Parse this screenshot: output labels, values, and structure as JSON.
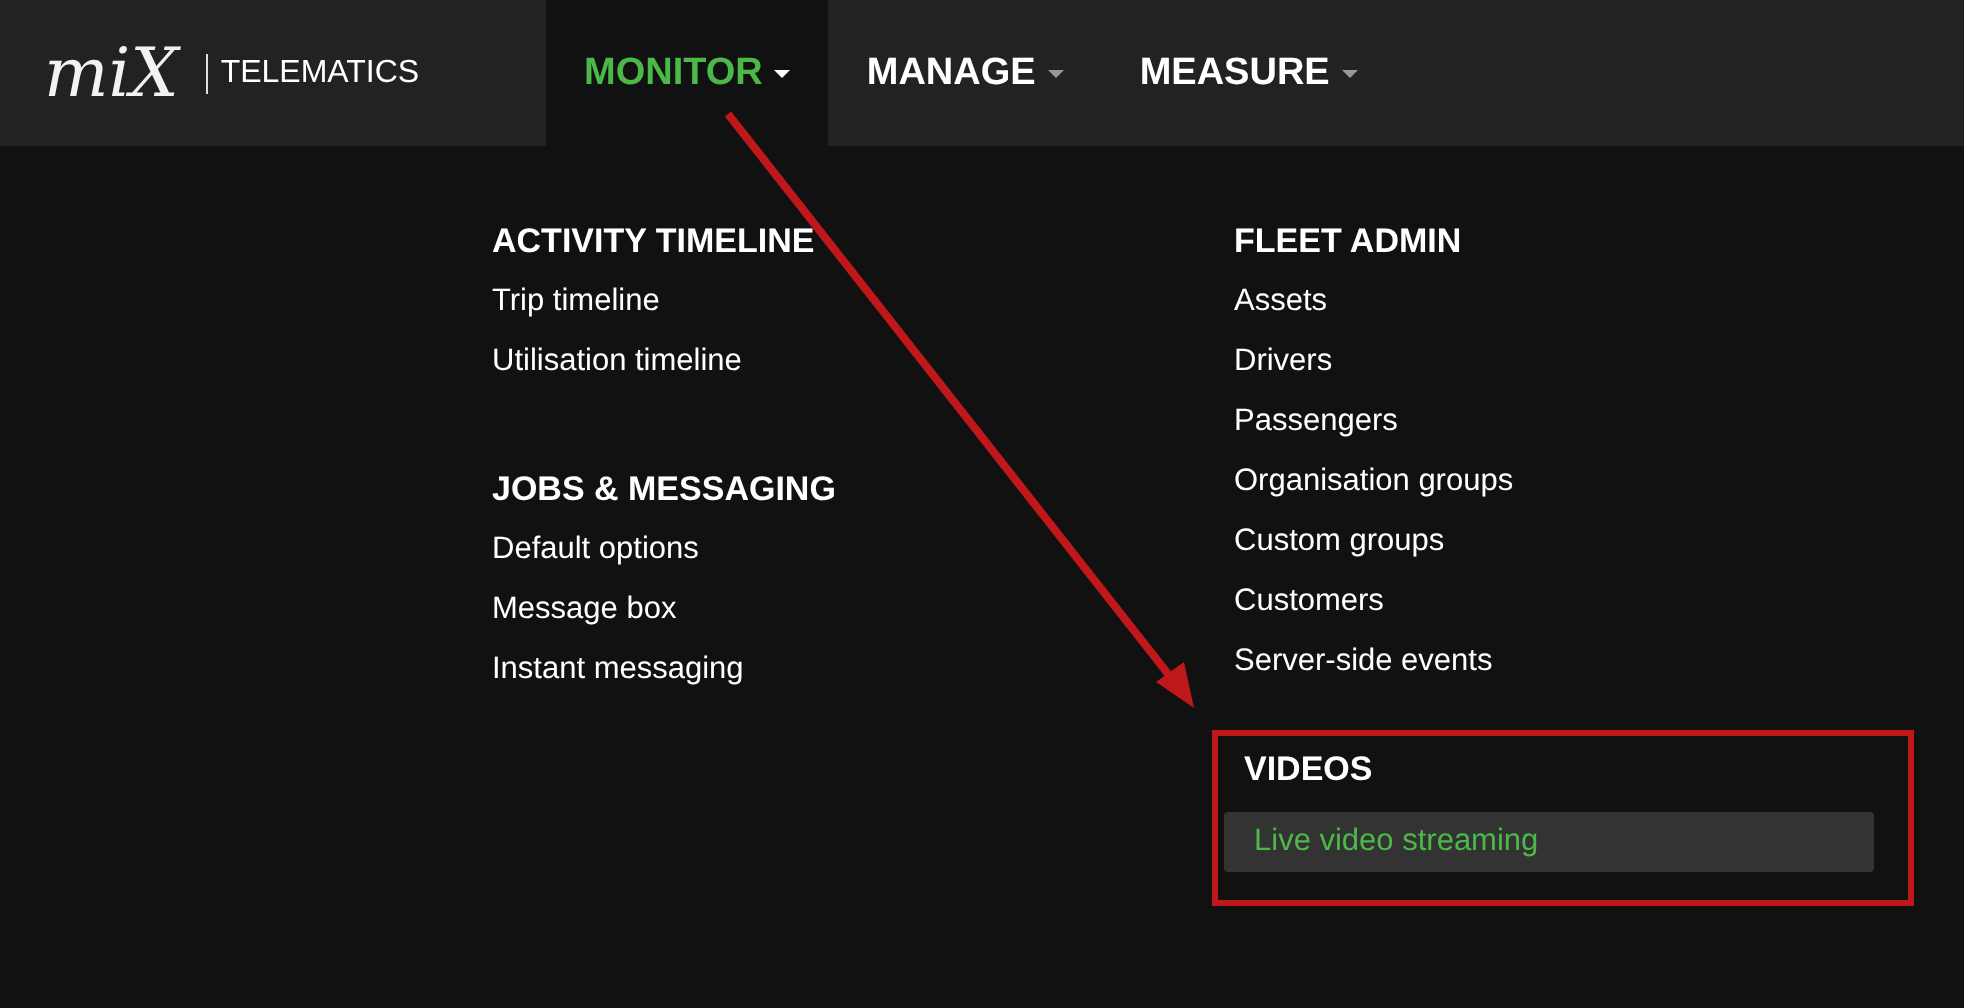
{
  "logo": {
    "mark": "miX",
    "text": "TELEMATICS"
  },
  "nav": [
    {
      "label": "MONITOR",
      "selected": true
    },
    {
      "label": "MANAGE",
      "selected": false
    },
    {
      "label": "MEASURE",
      "selected": false
    }
  ],
  "menu_columns": [
    {
      "sections": [
        {
          "title": "ACTIVITY TIMELINE",
          "highlighted": false,
          "items": [
            {
              "label": "Trip timeline",
              "selected": false
            },
            {
              "label": "Utilisation timeline",
              "selected": false
            }
          ]
        },
        {
          "title": "JOBS & MESSAGING",
          "highlighted": false,
          "items": [
            {
              "label": "Default options",
              "selected": false
            },
            {
              "label": "Message box",
              "selected": false
            },
            {
              "label": "Instant messaging",
              "selected": false
            }
          ]
        }
      ]
    },
    {
      "sections": [
        {
          "title": "FLEET ADMIN",
          "highlighted": false,
          "items": [
            {
              "label": "Assets",
              "selected": false
            },
            {
              "label": "Drivers",
              "selected": false
            },
            {
              "label": "Passengers",
              "selected": false
            },
            {
              "label": "Organisation groups",
              "selected": false
            },
            {
              "label": "Custom groups",
              "selected": false
            },
            {
              "label": "Customers",
              "selected": false
            },
            {
              "label": "Server-side events",
              "selected": false
            }
          ]
        },
        {
          "title": "VIDEOS",
          "highlighted": true,
          "items": [
            {
              "label": "Live video streaming",
              "selected": true
            }
          ]
        }
      ]
    }
  ]
}
